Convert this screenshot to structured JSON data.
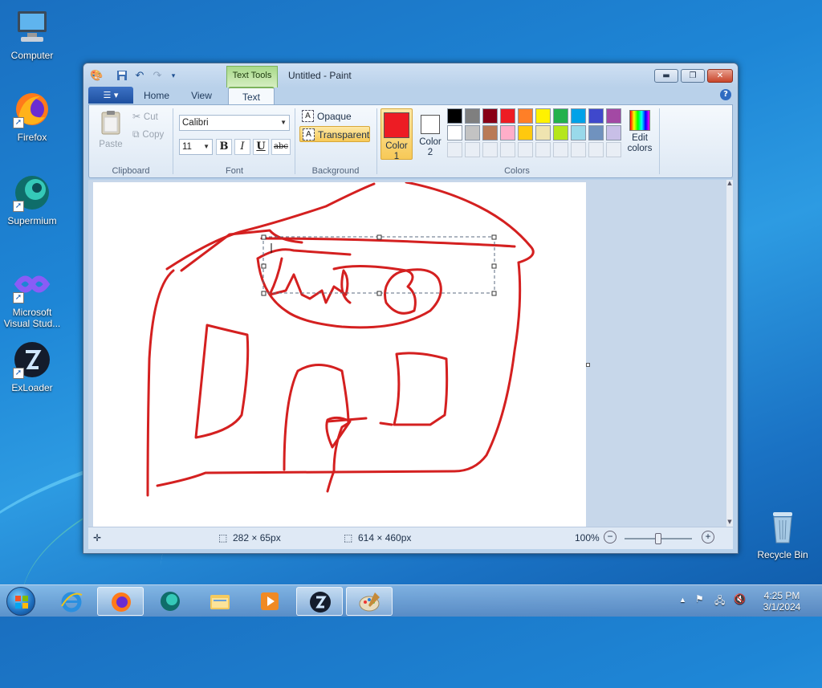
{
  "desktop": {
    "icons": [
      {
        "label": "Computer",
        "icon": "computer-icon"
      },
      {
        "label": "Firefox",
        "icon": "firefox-icon"
      },
      {
        "label": "Supermium",
        "icon": "supermium-icon"
      },
      {
        "label": "Microsoft Visual Stud...",
        "line1": "Microsoft",
        "line2": "Visual Stud...",
        "icon": "visual-studio-icon"
      },
      {
        "label": "ExLoader",
        "icon": "exloader-icon"
      },
      {
        "label": "Recycle Bin",
        "icon": "recycle-bin-icon"
      }
    ]
  },
  "window": {
    "title": "Untitled - Paint",
    "context_tab": "Text Tools",
    "tabs": {
      "home": "Home",
      "view": "View",
      "text": "Text"
    },
    "help": "?"
  },
  "ribbon": {
    "clipboard": {
      "label": "Clipboard",
      "paste": "Paste",
      "cut": "Cut",
      "copy": "Copy"
    },
    "font": {
      "label": "Font",
      "family": "Calibri",
      "size": "11",
      "bold": "B",
      "italic": "I",
      "underline": "U",
      "strike": "abc"
    },
    "background": {
      "label": "Background",
      "opaque": "Opaque",
      "transparent": "Transparent",
      "selected": "Transparent"
    },
    "colors": {
      "label": "Colors",
      "color1_label": "Color",
      "color1_num": "1",
      "color1_value": "#ed1c24",
      "color2_label": "Color",
      "color2_num": "2",
      "color2_value": "#ffffff",
      "edit_line1": "Edit",
      "edit_line2": "colors",
      "palette_row1": [
        "#000000",
        "#7f7f7f",
        "#880015",
        "#ed1c24",
        "#ff7f27",
        "#fff200",
        "#22b14c",
        "#00a2e8",
        "#3f48cc",
        "#a349a4"
      ],
      "palette_row2": [
        "#ffffff",
        "#c3c3c3",
        "#b97a57",
        "#ffaec9",
        "#ffc90e",
        "#efe4b0",
        "#b5e61d",
        "#99d9ea",
        "#7092be",
        "#c8bfe7"
      ]
    }
  },
  "status": {
    "selection_size": "282 × 65px",
    "image_size": "614 × 460px",
    "zoom": "100%"
  },
  "taskbar": {
    "time": "4:25 PM",
    "date": "3/1/2024",
    "apps": [
      "internet-explorer-icon",
      "firefox-icon",
      "supermium-icon",
      "file-explorer-icon",
      "media-player-icon",
      "exloader-icon",
      "paint-icon"
    ]
  },
  "drawing_color": "#d42020"
}
